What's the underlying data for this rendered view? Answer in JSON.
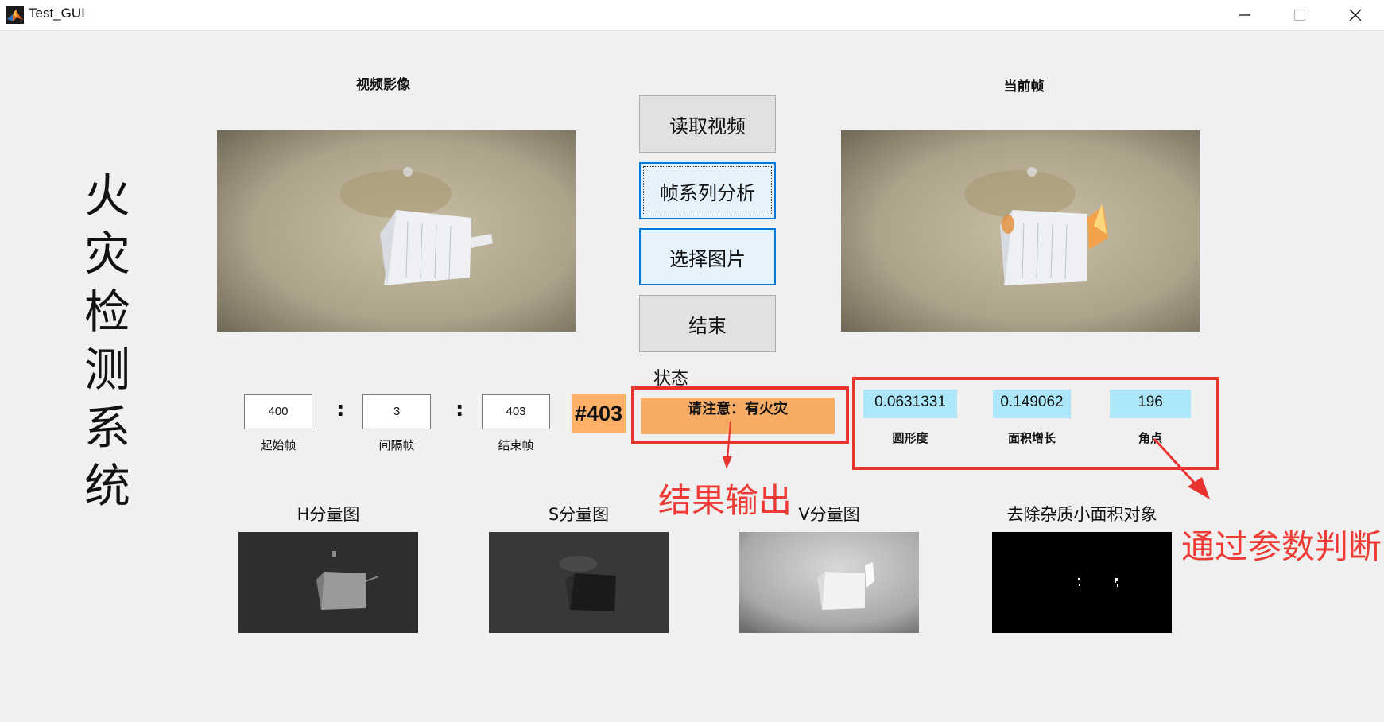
{
  "window": {
    "title": "Test_GUI",
    "icon": "matlab-icon",
    "controls": [
      "minimize-icon",
      "maximize-icon",
      "close-icon"
    ]
  },
  "main_title": [
    "火",
    "灾",
    "检",
    "测",
    "系",
    "统"
  ],
  "panels": {
    "video_caption": "视频影像",
    "current_frame_caption": "当前帧"
  },
  "buttons": {
    "read_video": "读取视频",
    "frame_analysis": "帧系列分析",
    "select_image": "选择图片",
    "end": "结束"
  },
  "frames": {
    "start_value": "400",
    "start_label": "起始帧",
    "interval_value": "3",
    "interval_label": "间隔帧",
    "end_value": "403",
    "end_label": "结束帧",
    "separator": ":",
    "current_frame": "#403"
  },
  "status": {
    "label": "状态",
    "text": "请注意：有火灾",
    "color": "#f7ac66"
  },
  "parameters": [
    {
      "value": "0.0631331",
      "label": "圆形度"
    },
    {
      "value": "0.149062",
      "label": "面积增长"
    },
    {
      "value": "196",
      "label": "角点"
    }
  ],
  "channels": {
    "h": "H分量图",
    "s": "S分量图",
    "v": "V分量图",
    "clean": "去除杂质小面积对象"
  },
  "annotations": {
    "result_output": "结果输出",
    "param_judge": "通过参数判断",
    "highlight_color": "#e8332f"
  }
}
